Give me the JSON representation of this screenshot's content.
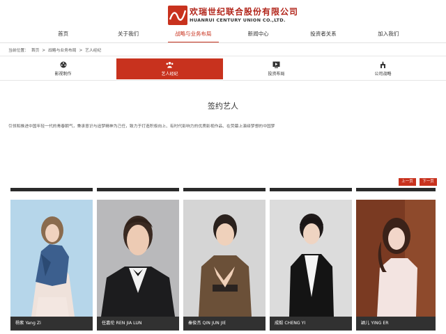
{
  "brand": {
    "name_cn": "欢瑞世纪联合股份有限公司",
    "name_en": "HUANRUI CENTURY UNION CO.,LTD."
  },
  "nav": {
    "items": [
      "首页",
      "关于我们",
      "战略与业务布局",
      "新闻中心",
      "投资者关系",
      "加入我们"
    ],
    "active": "战略与业务布局"
  },
  "breadcrumb": {
    "prefix": "当前位置：",
    "items": [
      "首页",
      ">",
      "战略与业务布局",
      ">",
      "艺人经纪"
    ]
  },
  "subtabs": {
    "items": [
      {
        "label": "影视制作",
        "icon": "film-reel-icon"
      },
      {
        "label": "艺人经纪",
        "icon": "people-icon"
      },
      {
        "label": "投资布局",
        "icon": "play-screen-icon"
      },
      {
        "label": "公司战略",
        "icon": "tower-icon"
      }
    ],
    "active": "艺人经纪"
  },
  "section": {
    "title": "签约艺人",
    "intro": "引领和推进中国年轻一代的青春朝气，秉承意识与追梦精神为己任，致力于打造积极向上、有时代影响力的优质影视作品、在荧幕上演绎梦想的中国梦"
  },
  "pager": {
    "prev": "上一页",
    "next": "下一页"
  },
  "artists": [
    {
      "caption": "杨紫 Yang Zi"
    },
    {
      "caption": "任嘉伦 REN JIA LUN"
    },
    {
      "caption": "秦俊杰 QIN JUN JIE"
    },
    {
      "caption": "成毅 CHENG YI"
    },
    {
      "caption": "颖儿 YING ER"
    }
  ],
  "colors": {
    "accent": "#c8321e",
    "caption_bg": "#141414"
  }
}
